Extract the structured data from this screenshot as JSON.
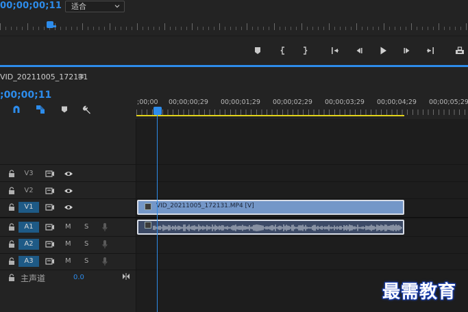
{
  "source_monitor": {
    "timecode": "00;00;00;11",
    "zoom_select": {
      "value": "适合"
    },
    "transport_icons": [
      "marker-icon",
      "mark-in-icon",
      "mark-out-icon",
      "go-to-in-icon",
      "step-back-icon",
      "play-icon",
      "step-forward-icon",
      "go-to-out-icon",
      "export-frame-icon"
    ]
  },
  "timeline": {
    "sequence_name": "VID_20211005_172131",
    "menu_glyph": "≡",
    "timecode": ";00;00;11",
    "tools": [
      "snap-icon",
      "linked-selection-icon",
      "add-marker-icon",
      "settings-wrench-icon"
    ],
    "ruler_labels": [
      ";00;00",
      "00;00;00;29",
      "00;00;01;29",
      "00;00;02;29",
      "00;00;03;29",
      "00;00;04;29",
      "00;00;05;29"
    ],
    "video_tracks": [
      {
        "name": "V3",
        "targeted": false
      },
      {
        "name": "V2",
        "targeted": false
      },
      {
        "name": "V1",
        "targeted": true
      }
    ],
    "audio_tracks": [
      {
        "name": "A1",
        "mute": "M",
        "solo": "S",
        "targeted": true
      },
      {
        "name": "A2",
        "mute": "M",
        "solo": "S",
        "targeted": true
      },
      {
        "name": "A3",
        "mute": "M",
        "solo": "S",
        "targeted": true
      }
    ],
    "master": {
      "label": "主声道",
      "value": "0.0"
    },
    "video_clip": {
      "name": "VID_20211005_172131.MP4 [V]"
    },
    "colors": {
      "accent": "#2d8ceb",
      "work_area": "#e3d41a",
      "video_clip": "#7497c8",
      "audio_clip": "#3c4a66"
    }
  },
  "watermark": "最需教育"
}
